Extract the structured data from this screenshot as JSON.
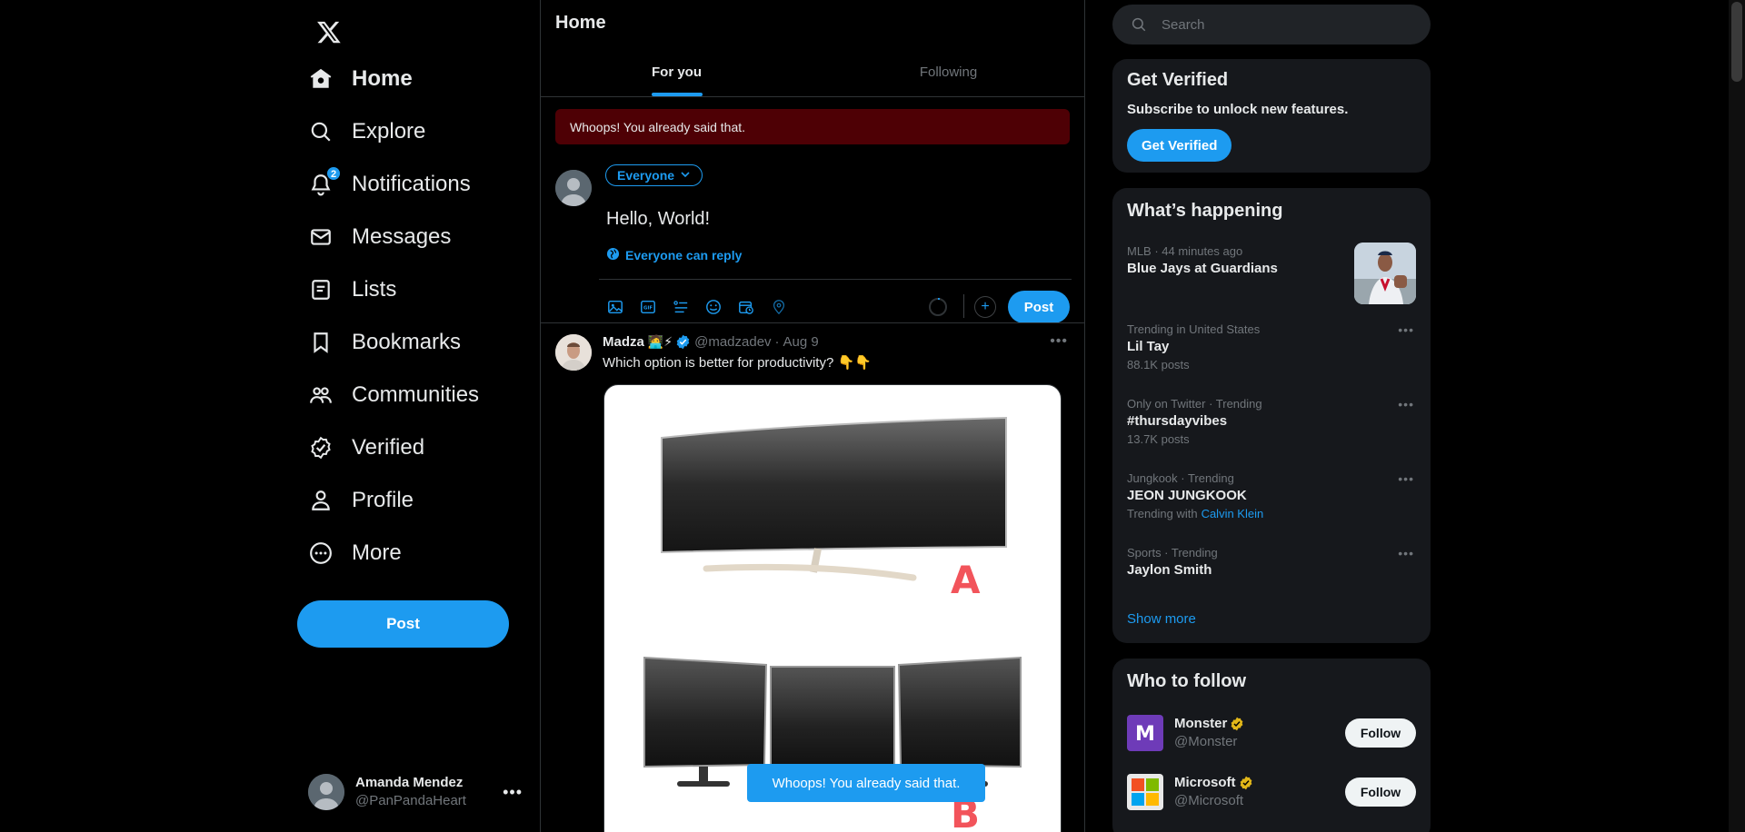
{
  "nav": {
    "items": [
      {
        "label": "Home",
        "icon": "home-icon"
      },
      {
        "label": "Explore",
        "icon": "search-icon"
      },
      {
        "label": "Notifications",
        "icon": "bell-icon",
        "badge": "2"
      },
      {
        "label": "Messages",
        "icon": "envelope-icon"
      },
      {
        "label": "Lists",
        "icon": "list-icon"
      },
      {
        "label": "Bookmarks",
        "icon": "bookmark-icon"
      },
      {
        "label": "Communities",
        "icon": "people-icon"
      },
      {
        "label": "Verified",
        "icon": "verified-badge-icon"
      },
      {
        "label": "Profile",
        "icon": "person-icon"
      },
      {
        "label": "More",
        "icon": "more-circle-icon"
      }
    ],
    "post_label": "Post"
  },
  "account": {
    "name": "Amanda Mendez",
    "handle": "@PanPandaHeart"
  },
  "main": {
    "title": "Home",
    "tabs": [
      {
        "label": "For you"
      },
      {
        "label": "Following"
      }
    ],
    "error": "Whoops! You already said that.",
    "composer": {
      "audience": "Everyone",
      "text": "Hello, World!",
      "reply_setting": "Everyone can reply",
      "post_label": "Post"
    },
    "tweet": {
      "name": "Madza",
      "emoji": "🧑‍💻⚡",
      "handle": "@madzadev",
      "date": "Aug 9",
      "text": "Which option is better for productivity? 👇👇",
      "labels": [
        "A",
        "B"
      ]
    },
    "toast": "Whoops! You already said that."
  },
  "right": {
    "search_placeholder": "Search",
    "get_verified": {
      "title": "Get Verified",
      "subtitle": "Subscribe to unlock new features.",
      "button": "Get Verified"
    },
    "happening": {
      "title": "What’s happening",
      "trends": [
        {
          "context": "MLB · 44 minutes ago",
          "title": "Blue Jays at Guardians",
          "count": ""
        },
        {
          "context": "Trending in United States",
          "title": "Lil Tay",
          "count": "88.1K posts"
        },
        {
          "context": "Only on Twitter · Trending",
          "title": "#thursdayvibes",
          "count": "13.7K posts"
        },
        {
          "context": "Jungkook · Trending",
          "title": "JEON JUNGKOOK",
          "count": "Trending with",
          "link": "Calvin Klein"
        },
        {
          "context": "Sports · Trending",
          "title": "Jaylon Smith",
          "count": ""
        }
      ],
      "show_more": "Show more"
    },
    "who_to_follow": {
      "title": "Who to follow",
      "accounts": [
        {
          "name": "Monster",
          "handle": "@Monster",
          "button": "Follow"
        },
        {
          "name": "Microsoft",
          "handle": "@Microsoft",
          "button": "Follow"
        }
      ]
    }
  },
  "colors": {
    "accent": "#1d9bf0",
    "background": "#000000",
    "error": "#4e0005",
    "gold": "#e2b719"
  }
}
